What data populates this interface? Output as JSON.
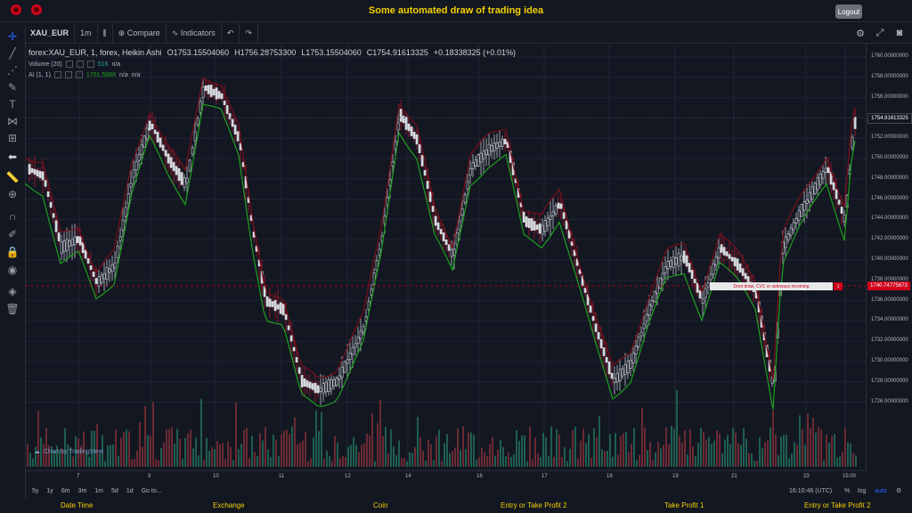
{
  "app": {
    "title": "Some automated draw of trading idea",
    "logout_label": "Logout"
  },
  "toolbar": {
    "symbol": "XAU_EUR",
    "interval": "1m",
    "compare_label": "Compare",
    "indicators_label": "Indicators"
  },
  "legend": {
    "series": "forex:XAU_EUR, 1, forex, Heikin Ashi",
    "o": "O1753.15504060",
    "h": "H1756.28753300",
    "l": "L1753.15504060",
    "c": "C1754.91613325",
    "change": "+0.18338325 (+0.01%)",
    "volume_label": "Volume (20)",
    "volume_value": "516",
    "volume_extra": "n/a",
    "ai_label": "AI (1, 1)",
    "ai_value": "1751.5868",
    "ai_na1": "n/a",
    "ai_na2": "n/a"
  },
  "price_scale": {
    "ticks": [
      "1760.00000000",
      "1758.00000000",
      "1756.00000000",
      "1754.00000000",
      "1752.00000000",
      "1750.00000000",
      "1748.00000000",
      "1746.00000000",
      "1744.00000000",
      "1742.00000000",
      "1740.00000000",
      "1738.00000000",
      "1736.00000000",
      "1734.00000000",
      "1732.00000000",
      "1730.00000000",
      "1728.00000000",
      "1726.00000000"
    ],
    "current": "1754.91613325",
    "marker": "1740.74775673"
  },
  "time_axis": {
    "labels": [
      "7",
      "9",
      "10",
      "11",
      "12",
      "14",
      "16",
      "17",
      "18",
      "19",
      "21",
      "23",
      "15:00"
    ]
  },
  "tooltip": {
    "text": "Dont draw, CVC or sideways incoming",
    "marker": "1"
  },
  "watermark": "Chart by TradingView",
  "bottom": {
    "ranges": [
      "5y",
      "1y",
      "6m",
      "3m",
      "1m",
      "5d",
      "1d"
    ],
    "goto": "Go to...",
    "time": "16:10:46 (UTC)",
    "pct": "%",
    "log": "log",
    "auto": "auto"
  },
  "footer": [
    "Date Time",
    "Exchange",
    "Coin",
    "Entry or Take Profit 2",
    "Take Profit 1",
    "Entry or Take Profit 2"
  ],
  "colors": {
    "up": "#26a69a",
    "down": "#ef5350",
    "accent": "#f4d000",
    "green_line": "#1e9e1e",
    "red_line": "#8b0000"
  }
}
